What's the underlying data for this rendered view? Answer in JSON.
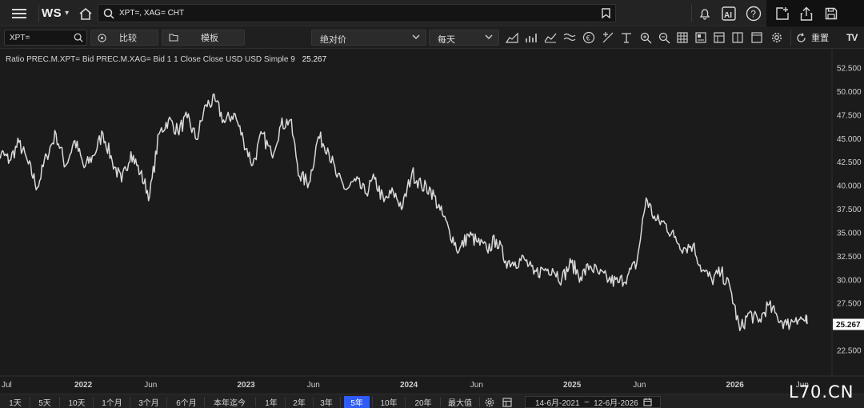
{
  "topbar": {
    "logo": "WS",
    "search_value": "XPT=, XAG= CHT",
    "icons": [
      "menu-icon",
      "home-icon",
      "search-icon",
      "bookmark-icon",
      "bell-icon",
      "ai-icon",
      "help-icon",
      "new-window-icon",
      "share-icon",
      "save-icon"
    ]
  },
  "toolbar": {
    "symbol_value": "XPT=",
    "compare_label": "比较",
    "template_label": "模板",
    "price_mode": "绝对价",
    "interval": "每天",
    "reset_label": "重置",
    "brand": "TV"
  },
  "legend": {
    "text": "Ratio PREC.M.XPT= Bid PREC.M.XAG= Bid 1 1 Close Close USD USD Simple 9",
    "value": "25.267"
  },
  "chart_data": {
    "type": "line",
    "y_ticks": [
      "52.500",
      "50.000",
      "47.500",
      "45.000",
      "42.500",
      "40.000",
      "37.500",
      "35.000",
      "32.500",
      "30.000",
      "27.500",
      "25.000",
      "22.500"
    ],
    "x_ticks": [
      "Jul",
      "2022",
      "Jun",
      "2023",
      "Jun",
      "2024",
      "Jun",
      "2025",
      "Jun",
      "2026",
      "Jun"
    ],
    "last_value": "25.267",
    "ylim": [
      21.4,
      53.6
    ],
    "series": [
      {
        "x": [
          "2021-06-14",
          "2021-07-01",
          "2021-07-20",
          "2021-08-10",
          "2021-08-31",
          "2021-09-20",
          "2021-10-11",
          "2021-11-01",
          "2021-11-22",
          "2021-12-13",
          "2022-01-03",
          "2022-01-24",
          "2022-02-14",
          "2022-03-07",
          "2022-03-28",
          "2022-04-18",
          "2022-05-09",
          "2022-05-30",
          "2022-06-20",
          "2022-07-11",
          "2022-08-01",
          "2022-08-22",
          "2022-09-12",
          "2022-10-03",
          "2022-10-24",
          "2022-11-14",
          "2022-12-05",
          "2022-12-26",
          "2023-01-16",
          "2023-02-06",
          "2023-02-27",
          "2023-03-20",
          "2023-04-10",
          "2023-05-01",
          "2023-05-22",
          "2023-06-12",
          "2023-07-03",
          "2023-07-24",
          "2023-08-14",
          "2023-09-04",
          "2023-09-25",
          "2023-10-16",
          "2023-11-06",
          "2023-11-27",
          "2023-12-18",
          "2024-01-08",
          "2024-01-29",
          "2024-02-19",
          "2024-03-11",
          "2024-04-01",
          "2024-04-22",
          "2024-05-13",
          "2024-06-03",
          "2024-06-24",
          "2024-07-15",
          "2024-08-05",
          "2024-08-26",
          "2024-09-16",
          "2024-10-07",
          "2024-10-28",
          "2024-11-18",
          "2024-12-09",
          "2024-12-30",
          "2025-01-20",
          "2025-02-10",
          "2025-03-03",
          "2025-03-24",
          "2025-04-14",
          "2025-05-05",
          "2025-05-26",
          "2025-06-16",
          "2025-07-07",
          "2025-07-28",
          "2025-08-18",
          "2025-09-08",
          "2025-09-29",
          "2025-10-20",
          "2025-11-10",
          "2025-12-01",
          "2025-12-22",
          "2026-01-12",
          "2026-02-02",
          "2026-02-23",
          "2026-03-16",
          "2026-04-06",
          "2026-04-27",
          "2026-05-18",
          "2026-06-08",
          "2026-06-12"
        ],
        "values": [
          41.8,
          43.4,
          42.7,
          44.6,
          42.3,
          39.8,
          43.2,
          45.5,
          42.1,
          44.8,
          41.9,
          43.2,
          45.6,
          42.6,
          40.4,
          43.6,
          41.3,
          38.9,
          45.5,
          47.0,
          45.8,
          47.2,
          44.9,
          48.6,
          49.0,
          46.7,
          47.7,
          44.9,
          42.2,
          45.5,
          43.3,
          46.4,
          47.0,
          41.0,
          40.3,
          45.2,
          44.0,
          40.9,
          39.6,
          40.5,
          39.2,
          40.7,
          38.3,
          39.3,
          37.7,
          41.4,
          40.0,
          39.6,
          37.4,
          35.2,
          33.0,
          34.8,
          34.0,
          33.2,
          34.3,
          32.0,
          31.9,
          32.2,
          30.6,
          31.1,
          31.2,
          30.1,
          31.8,
          30.3,
          31.5,
          30.6,
          30.0,
          29.7,
          30.4,
          31.8,
          38.7,
          36.3,
          36.0,
          34.5,
          33.4,
          33.7,
          31.0,
          30.0,
          30.8,
          29.0,
          24.6,
          26.5,
          25.5,
          27.3,
          26.1,
          25.2,
          26.0,
          25.7,
          25.3
        ]
      }
    ]
  },
  "rangebar": {
    "buttons": [
      "1天",
      "5天",
      "10天",
      "1个月",
      "3个月",
      "6个月",
      "本年迄今",
      "1年",
      "2年",
      "3年",
      "5年",
      "10年",
      "20年",
      "最大值"
    ],
    "active": "5年",
    "date_start": "14-6月-2021",
    "date_sep": "–",
    "date_end": "12-6月-2026"
  },
  "watermark": "L70.CN",
  "colors": {
    "background": "#1b1b1b",
    "line": "#d9d9d9",
    "active": "#2e5bff",
    "last_value_bg": "#ffffff"
  }
}
